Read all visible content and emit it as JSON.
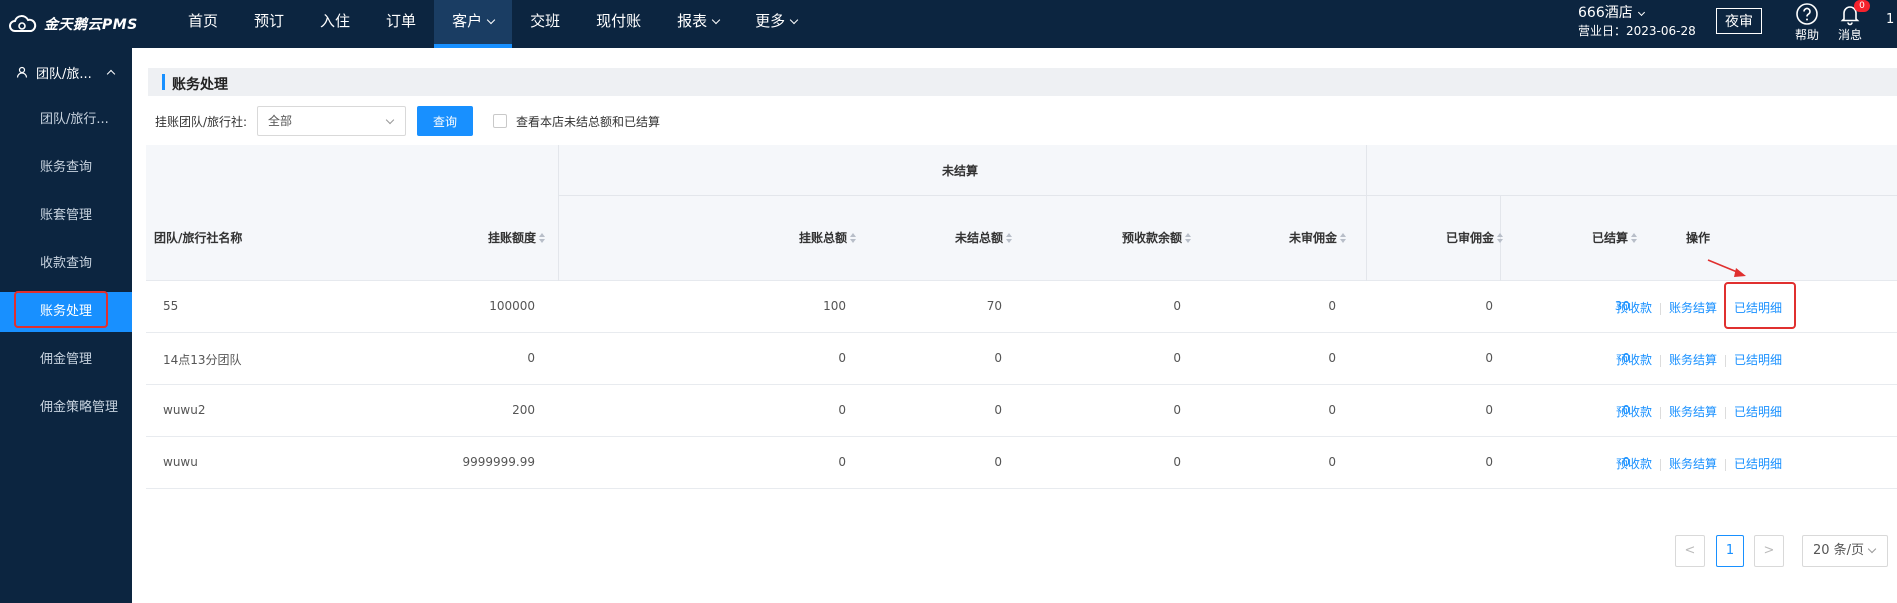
{
  "topbar": {
    "logo_text": "金天鹅云PMS",
    "nav": [
      {
        "label": "首页",
        "caret": false
      },
      {
        "label": "预订",
        "caret": false
      },
      {
        "label": "入住",
        "caret": false
      },
      {
        "label": "订单",
        "caret": false
      },
      {
        "label": "客户",
        "caret": true,
        "active": true
      },
      {
        "label": "交班",
        "caret": false
      },
      {
        "label": "现付账",
        "caret": false
      },
      {
        "label": "报表",
        "caret": true
      },
      {
        "label": "更多",
        "caret": true
      }
    ],
    "hotel_name": "666酒店",
    "business_date": "营业日：2023-06-28",
    "night_audit": "夜审",
    "help_label": "帮助",
    "messages_label": "消息",
    "message_badge": "0",
    "user_num": "1"
  },
  "sidebar": {
    "group_label": "团队/旅...",
    "items": [
      {
        "label": "团队/旅行..."
      },
      {
        "label": "账务查询"
      },
      {
        "label": "账套管理"
      },
      {
        "label": "收款查询"
      },
      {
        "label": "账务处理",
        "active": true
      },
      {
        "label": "佣金管理"
      },
      {
        "label": "佣金策略管理"
      }
    ]
  },
  "main": {
    "section_title": "账务处理",
    "filter": {
      "label": "挂账团队/旅行社:",
      "select_value": "全部",
      "query_button": "查询",
      "checkbox_label": "查看本店未结总额和已结算"
    },
    "table": {
      "group_unsettled": "未结算",
      "headers": {
        "name": "团队/旅行社名称",
        "credit_limit": "挂账额度",
        "total": "挂账总额",
        "unsettled": "未结总额",
        "prepay_balance": "预收款余额",
        "unaudited_commission": "未审佣金",
        "audited_commission": "已审佣金",
        "settled": "已结算",
        "ops": "操作"
      },
      "rows": [
        {
          "name": "55",
          "credit_limit": "100000",
          "total": "100",
          "unsettled": "70",
          "prepay_balance": "0",
          "unaudited_commission": "0",
          "audited_commission": "0",
          "settled": "30"
        },
        {
          "name": "14点13分团队",
          "credit_limit": "0",
          "total": "0",
          "unsettled": "0",
          "prepay_balance": "0",
          "unaudited_commission": "0",
          "audited_commission": "0",
          "settled": "0"
        },
        {
          "name": "wuwu2",
          "credit_limit": "200",
          "total": "0",
          "unsettled": "0",
          "prepay_balance": "0",
          "unaudited_commission": "0",
          "audited_commission": "0",
          "settled": "0"
        },
        {
          "name": "wuwu",
          "credit_limit": "9999999.99",
          "total": "0",
          "unsettled": "0",
          "prepay_balance": "0",
          "unaudited_commission": "0",
          "audited_commission": "0",
          "settled": "0"
        }
      ],
      "ops_labels": {
        "prepay": "预收款",
        "settle": "账务结算",
        "detail": "已结明细"
      }
    },
    "pagination": {
      "prev": "<",
      "page": "1",
      "next": ">",
      "page_size": "20 条/页"
    }
  },
  "colors": {
    "nav_bg": "#0c2540",
    "accent": "#1890ff",
    "highlight": "#e0302f"
  }
}
